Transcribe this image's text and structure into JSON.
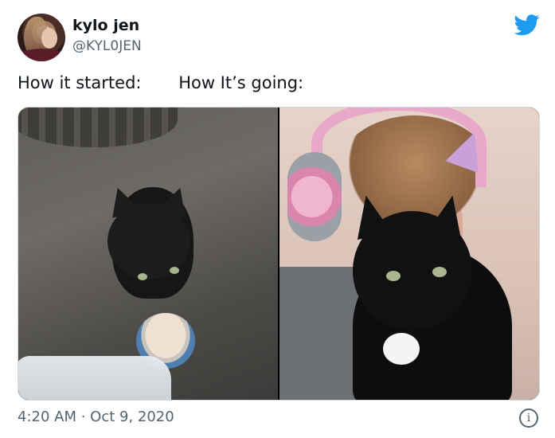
{
  "author": {
    "display_name": "kylo jen",
    "handle": "@KYL0JEN",
    "avatar_icon": "avatar-photo"
  },
  "brand": {
    "icon": "twitter-bird-icon",
    "color": "#1d9bf0"
  },
  "tweet": {
    "text": "How it started:       How It’s going:"
  },
  "media": {
    "left_image": "photo-kitten-with-cat-food-can",
    "right_image": "photo-black-cat-with-person-wearing-pink-headset"
  },
  "meta": {
    "timestamp": "4:20 AM · Oct 9, 2020",
    "info_icon": "info-icon",
    "info_glyph": "i"
  }
}
